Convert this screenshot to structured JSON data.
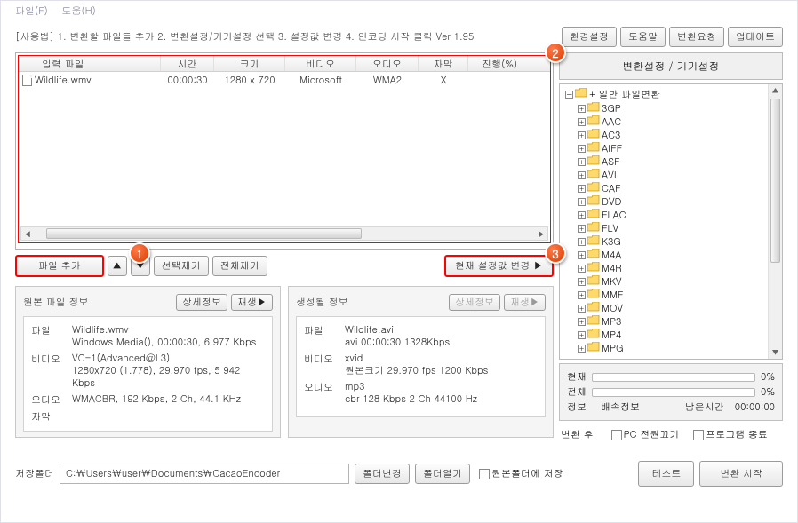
{
  "menu": {
    "file": "파일(F)",
    "help": "도움(H)"
  },
  "instructions": "[사용법] 1. 변환할 파일들 추가    2. 변환설정/기기설정 선택    3. 설정값 변경    4. 인코딩 시작 클릭    Ver 1.95",
  "toolbar_buttons": {
    "settings": "환경설정",
    "help": "도움말",
    "req": "변환요청",
    "update": "업데이트"
  },
  "table_headers": {
    "input": "입력 파일",
    "time": "시간",
    "size": "크기",
    "video": "비디오",
    "audio": "오디오",
    "subtitle": "자막",
    "progress": "진행(%)"
  },
  "file_row": {
    "name": "Wildlife.wmv",
    "time": "00:00:30",
    "size": "1280 x 720",
    "video": "Microsoft",
    "audio": "WMA2",
    "subtitle": "X",
    "progress": ""
  },
  "badges": {
    "one": "1",
    "two": "2",
    "three": "3"
  },
  "actions": {
    "add_file": "파일 추가",
    "up": "▲",
    "down": "▼",
    "remove_sel": "선택제거",
    "remove_all": "전체제거",
    "change_cur": "현재 설정값 변경 ▶"
  },
  "src_panel": {
    "title": "원본 파일 정보",
    "detail": "상세정보",
    "play": "재생▶",
    "file_label": "파일",
    "file_val_1": "Wildlife.wmv",
    "file_val_2": "Windows Media(), 00:00:30, 6 977 Kbps",
    "video_label": "비디오",
    "video_val_1": "VC-1(Advanced@L3)",
    "video_val_2": "1280x720 (1.778), 29.970 fps, 5 942 Kbps",
    "audio_label": "오디오",
    "audio_val": "WMACBR, 192 Kbps, 2 Ch, 44.1 KHz",
    "sub_label": "자막"
  },
  "out_panel": {
    "title": "생성될 정보",
    "detail": "상세정보",
    "play": "재생▶",
    "file_label": "파일",
    "file_val_1": "Wildlife.avi",
    "file_val_2": "avi  00:00:30  1328Kbps",
    "video_label": "비디오",
    "video_val_1": "xvid",
    "video_val_2": "원본크기  29.970 fps    1200 Kbps",
    "audio_label": "오디오",
    "audio_val_1": "mp3",
    "audio_val_2": "cbr    128 Kbps    2 Ch    44100 Hz"
  },
  "right": {
    "header": "변환설정 / 기기설정",
    "root_expand": "−",
    "root_label": "+ 일반 파일변환",
    "items": [
      "3GP",
      "AAC",
      "AC3",
      "AIFF",
      "ASF",
      "AVI",
      "CAF",
      "DVD",
      "FLAC",
      "FLV",
      "K3G",
      "M4A",
      "M4R",
      "MKV",
      "MMF",
      "MOV",
      "MP3",
      "MP4",
      "MPG"
    ]
  },
  "progress": {
    "current_label": "현재",
    "current_pct": "0%",
    "total_label": "전체",
    "total_pct": "0%",
    "info_label": "정보",
    "speed_label": "배속정보",
    "remain_label": "남은시간",
    "remain_val": "00:00:00",
    "after_label": "변환 후",
    "pc_off": "PC 전원끄기",
    "prog_exit": "프로그램 종료"
  },
  "bottom": {
    "folder_label": "저장폴더",
    "path": "C:\\Users\\user\\Documents\\CacaoEncoder",
    "path_display": "C:￦Users￦user￦Documents￦CacaoEncoder",
    "change_folder": "폴더변경",
    "open_folder": "폴더열기",
    "save_in_source": "원본폴더에 저장",
    "test": "테스트",
    "start": "변환 시작"
  }
}
